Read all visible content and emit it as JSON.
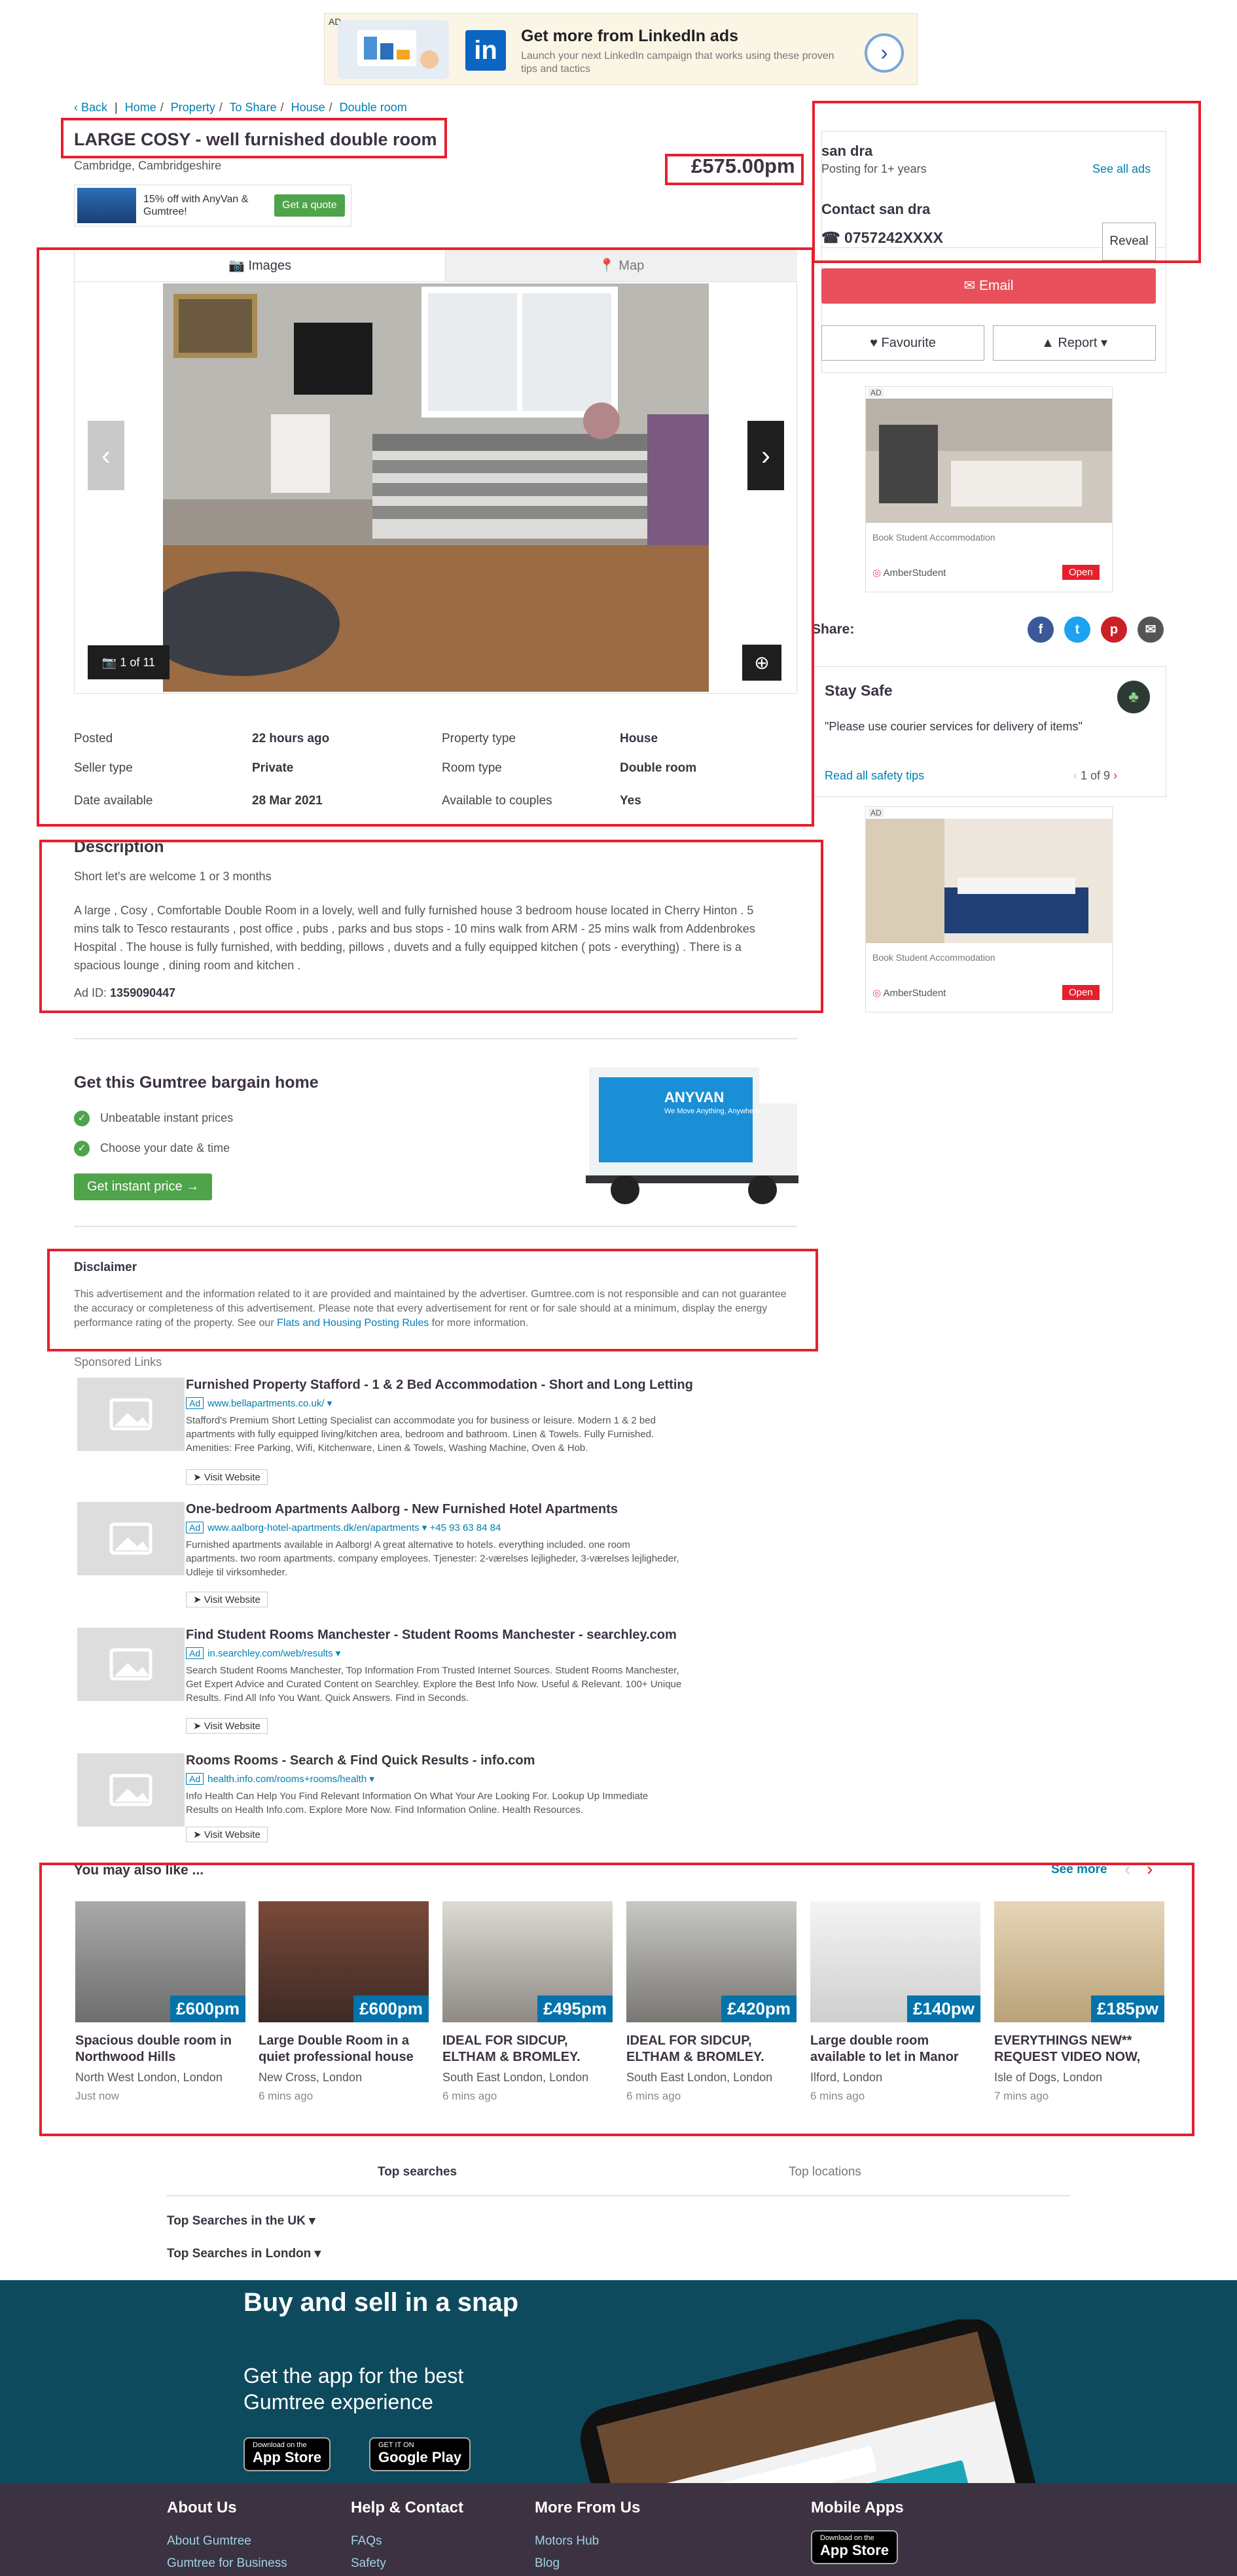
{
  "top_ad": {
    "ad_label": "AD",
    "headline": "Get more from LinkedIn ads",
    "subtext": "Launch your next LinkedIn campaign that works using these proven tips and tactics",
    "brand": "in"
  },
  "breadcrumb": {
    "back": "Back",
    "items": [
      "Home",
      "Property",
      "To Share",
      "House",
      "Double room"
    ]
  },
  "listing": {
    "title": "LARGE COSY - well furnished double room",
    "location": "Cambridge, Cambridgeshire",
    "price": "£575.00pm"
  },
  "promo": {
    "text": "15% off with AnyVan & Gumtree!",
    "button": "Get a quote"
  },
  "gallery": {
    "tab_images": "Images",
    "tab_map": "Map",
    "counter": "1 of 11"
  },
  "attributes": [
    {
      "label": "Posted",
      "value": "22 hours ago"
    },
    {
      "label": "Seller type",
      "value": "Private"
    },
    {
      "label": "Date available",
      "value": "28 Mar 2021"
    },
    {
      "label": "Property type",
      "value": "House"
    },
    {
      "label": "Room type",
      "value": "Double room"
    },
    {
      "label": "Available to couples",
      "value": "Yes"
    }
  ],
  "description": {
    "heading": "Description",
    "short": "Short let's are welcome 1 or 3 months",
    "body": "A large , Cosy , Comfortable Double Room in a lovely, well and fully furnished house 3 bedroom house located in Cherry Hinton . 5 mins talk to Tesco restaurants , post office , pubs , parks and bus stops - 10 mins walk from ARM - 25 mins walk from Addenbrokes Hospital . The house is fully furnished, with bedding, pillows , duvets and a fully equipped kitchen ( pots - everything) . There is a spacious lounge , dining room and kitchen .",
    "ad_id_label": "Ad ID:",
    "ad_id": "1359090447"
  },
  "bargain": {
    "heading": "Get this Gumtree bargain home",
    "point1": "Unbeatable instant prices",
    "point2": "Choose your date & time",
    "button": "Get instant price",
    "van_brand": "ANYVAN",
    "van_tagline": "We Move Anything, Anywhere"
  },
  "disclaimer": {
    "heading": "Disclaimer",
    "text": "This advertisement and the information related to it are provided and maintained by the advertiser. Gumtree.com is not responsible and can not guarantee the accuracy or completeness of this advertisement. Please note that every advertisement for rent or for sale should at a minimum, display the energy performance rating of the property. See our",
    "link": "Flats and Housing Posting Rules",
    "tail": "for more information."
  },
  "sponsored": {
    "heading": "Sponsored Links",
    "ad_tag": "Ad",
    "visit": "➤ Visit Website",
    "items": [
      {
        "title": "Furnished Property Stafford - 1 & 2 Bed Accommodation - Short and Long Letting",
        "url": "www.bellapartments.co.uk/ ▾",
        "desc": "Stafford's Premium Short Letting Specialist can accommodate you for business or leisure. Modern 1 & 2 bed apartments with fully equipped living/kitchen area, bedroom and bathroom. Linen & Towels. Fully Furnished. Amenities: Free Parking, Wifi, Kitchenware, Linen & Towels, Washing Machine, Oven & Hob."
      },
      {
        "title": "One-bedroom Apartments Aalborg - New Furnished Hotel Apartments",
        "url": "www.aalborg-hotel-apartments.dk/en/apartments ▾ +45 93 63 84 84",
        "desc": "Furnished apartments available in Aalborg! A great alternative to hotels. everything included. one room apartments. two room apartments. company employees. Tjenester: 2-værelses lejligheder, 3-værelses lejligheder, Udleje til virksomheder."
      },
      {
        "title": "Find Student Rooms Manchester - Student Rooms Manchester - searchley.com",
        "url": "in.searchley.com/web/results ▾",
        "desc": "Search Student Rooms Manchester, Top Information From Trusted Internet Sources. Student Rooms Manchester, Get Expert Advice and Curated Content on Searchley. Explore the Best Info Now. Useful & Relevant. 100+ Unique Results. Find All Info You Want. Quick Answers. Find in Seconds."
      },
      {
        "title": "Rooms Rooms - Search & Find Quick Results - info.com",
        "url": "health.info.com/rooms+rooms/health ▾",
        "desc": "Info Health Can Help You Find Relevant Information On What Your Are Looking For. Lookup Up Immediate Results on Health Info.com. Explore More Now. Find Information Online. Health Resources."
      }
    ]
  },
  "also_like": {
    "heading": "You may also like ...",
    "see_more": "See more",
    "cards": [
      {
        "price": "£600pm",
        "title": "Spacious double room in Northwood Hills",
        "location": "North West London, London",
        "time": "Just now"
      },
      {
        "price": "£600pm",
        "title": "Large Double Room in a quiet professional house",
        "location": "New Cross, London",
        "time": "6 mins ago"
      },
      {
        "price": "£495pm",
        "title": "IDEAL FOR SIDCUP, ELTHAM & BROMLEY.",
        "location": "South East London, London",
        "time": "6 mins ago"
      },
      {
        "price": "£420pm",
        "title": "IDEAL FOR SIDCUP, ELTHAM & BROMLEY.",
        "location": "South East London, London",
        "time": "6 mins ago"
      },
      {
        "price": "£140pw",
        "title": "Large double room available to let in Manor",
        "location": "Ilford, London",
        "time": "6 mins ago"
      },
      {
        "price": "£185pw",
        "title": "EVERYTHINGS NEW** REQUEST VIDEO NOW,",
        "location": "Isle of Dogs, London",
        "time": "7 mins ago"
      }
    ]
  },
  "top_searches": {
    "tab1": "Top searches",
    "tab2": "Top locations",
    "uk": "Top Searches in the UK",
    "london": "Top Searches in London"
  },
  "seller": {
    "name": "san dra",
    "posting": "Posting for 1+ years",
    "see_all": "See all ads",
    "contact": "Contact san dra",
    "phone": "0757242XXXX",
    "reveal": "Reveal",
    "email": "Email",
    "favourite": "Favourite",
    "report": "Report"
  },
  "side_ads": [
    {
      "label": "AD",
      "caption": "Book Student Accommodation",
      "brand": "AmberStudent",
      "cta": "Open"
    },
    {
      "label": "AD",
      "caption": "Book Student Accommodation",
      "brand": "AmberStudent",
      "cta": "Open"
    }
  ],
  "share": {
    "label": "Share:"
  },
  "stay_safe": {
    "heading": "Stay Safe",
    "quote": "\"Please use courier services for delivery of items\"",
    "link": "Read all safety tips",
    "pager": "1 of 9"
  },
  "app_promo": {
    "heading": "Buy and sell in a snap",
    "sub": "Get the app for the best Gumtree experience",
    "appstore_small": "Download on the",
    "appstore": "App Store",
    "gplay_small": "GET IT ON",
    "gplay": "Google Play"
  },
  "footer": {
    "col1": {
      "heading": "About Us",
      "l1": "About Gumtree",
      "l2": "Gumtree for Business"
    },
    "col2": {
      "heading": "Help & Contact",
      "l1": "FAQs",
      "l2": "Safety"
    },
    "col3": {
      "heading": "More From Us",
      "l1": "Motors Hub",
      "l2": "Blog"
    },
    "col4": {
      "heading": "Mobile Apps",
      "appstore_small": "Download on the",
      "appstore": "App Store"
    }
  },
  "colors": {
    "accent": "#007fb0",
    "red_box": "#e5202e",
    "email_btn": "#e8505b",
    "green": "#4fa34a",
    "price_tag": "#0473ab",
    "footer": "#3c3241",
    "band": "#0d4a5d"
  }
}
